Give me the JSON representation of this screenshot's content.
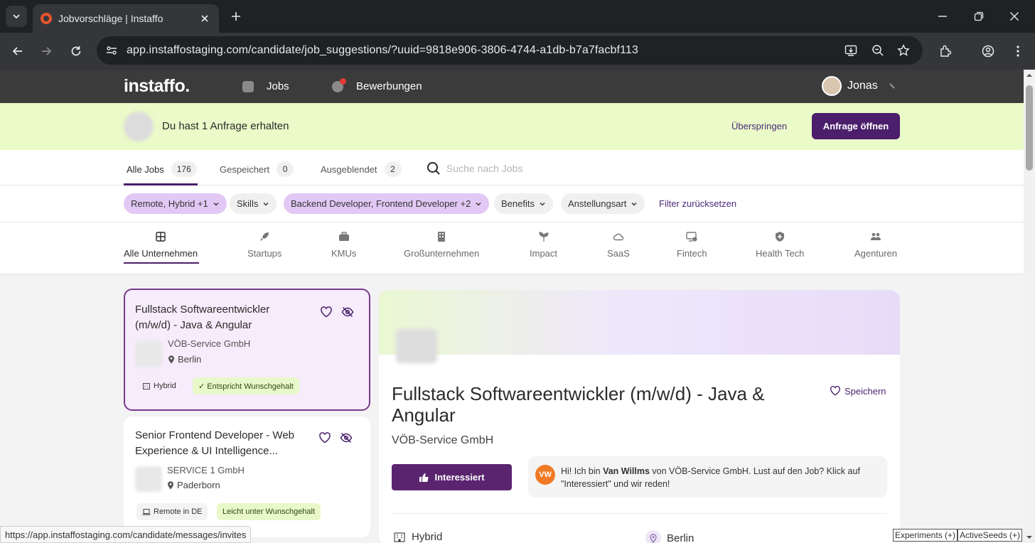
{
  "browser": {
    "tab_title": "Jobvorschläge | Instaffo",
    "url": "app.instaffostaging.com/candidate/job_suggestions/?uuid=9818e906-3806-4744-a1db-b7a7facbf113",
    "status_url": "https://app.instaffostaging.com/candidate/messages/invites"
  },
  "app_nav": {
    "logo": "instaffo.",
    "jobs": "Jobs",
    "applications": "Bewerbungen",
    "user": "Jonas"
  },
  "banner": {
    "text": "Du hast 1 Anfrage erhalten",
    "skip": "Überspringen",
    "open": "Anfrage öffnen"
  },
  "job_tabs": [
    {
      "label": "Alle Jobs",
      "count": "176"
    },
    {
      "label": "Gespeichert",
      "count": "0"
    },
    {
      "label": "Ausgeblendet",
      "count": "2"
    }
  ],
  "search": {
    "placeholder": "Suche nach Jobs"
  },
  "filters": [
    "Remote, Hybrid +1",
    "Skills",
    "Backend Developer, Frontend Developer +2",
    "Benefits",
    "Anstellungsart"
  ],
  "filter_reset": "Filter zurücksetzen",
  "categories": [
    {
      "label": "Alle Unternehmen",
      "icon": "grid-icon"
    },
    {
      "label": "Startups",
      "icon": "rocket-icon"
    },
    {
      "label": "KMUs",
      "icon": "briefcase-icon"
    },
    {
      "label": "Großunternehmen",
      "icon": "building-icon"
    },
    {
      "label": "Impact",
      "icon": "sprout-icon"
    },
    {
      "label": "SaaS",
      "icon": "cloud-icon"
    },
    {
      "label": "Fintech",
      "icon": "monitor-coin-icon"
    },
    {
      "label": "Health Tech",
      "icon": "health-icon"
    },
    {
      "label": "Agenturen",
      "icon": "people-icon"
    }
  ],
  "jobs": [
    {
      "title": "Fullstack Softwareentwickler (m/w/d) - Java & Angular",
      "company": "VÖB-Service GmbH",
      "location": "Berlin",
      "tags": [
        "Hybrid",
        "✓ Entspricht Wunschgehalt"
      ]
    },
    {
      "title": "Senior Frontend Developer - Web Experience & UI Intelligence...",
      "company": "SERVICE 1 GmbH",
      "location": "Paderborn",
      "tags": [
        "Remote in DE",
        "Leicht unter Wunschgehalt"
      ]
    }
  ],
  "detail": {
    "title": "Fullstack Softwareentwickler (m/w/d) - Java & Angular",
    "save": "Speichern",
    "company": "VÖB-Service GmbH",
    "interested": "Interessiert",
    "contact_initials": "VW",
    "message_pre": "Hi! Ich bin ",
    "message_name": "Van Willms",
    "message_post": " von VÖB-Service GmbH. Lust auf den Job? Klick auf \"Interessiert\" und wir reden!",
    "work_mode": "Hybrid",
    "location": "Berlin"
  },
  "devtools": {
    "experiments": "Experiments (+)",
    "seeds": "ActiveSeeds (+)"
  }
}
